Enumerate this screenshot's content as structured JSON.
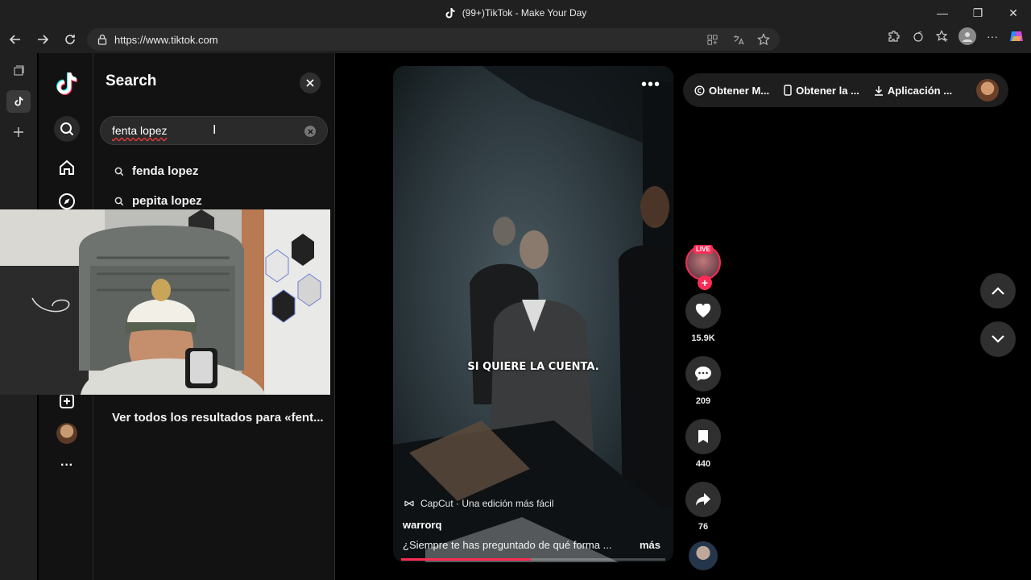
{
  "window": {
    "title": "(99+)TikTok - Make Your Day",
    "minimize": "—",
    "restore": "❐",
    "close": "✕"
  },
  "browser": {
    "url": "https://www.tiktok.com"
  },
  "search_panel": {
    "title": "Search",
    "query": "fenta lopez",
    "suggestions": [
      "fenda lopez",
      "pepita lopez"
    ],
    "see_all": "Ver todos los resultados para «fent..."
  },
  "top_bar": {
    "items": [
      "Obtener M...",
      "Obtener la ...",
      "Aplicación ..."
    ]
  },
  "video": {
    "caption": "SI QUIERE LA CUENTA.",
    "effect_label": "CapCut · Una edición más fácil",
    "author": "warrorq",
    "description": "¿Siempre te has preguntado de qué forma ...",
    "more_label": "más",
    "progress": 0.49,
    "live_badge": "LIVE",
    "follow_plus": "+"
  },
  "actions": {
    "likes": "15.9K",
    "comments": "209",
    "saves": "440",
    "shares": "76"
  },
  "colors": {
    "accent": "#fe2c55",
    "background": "#000000",
    "panel": "#121212"
  }
}
